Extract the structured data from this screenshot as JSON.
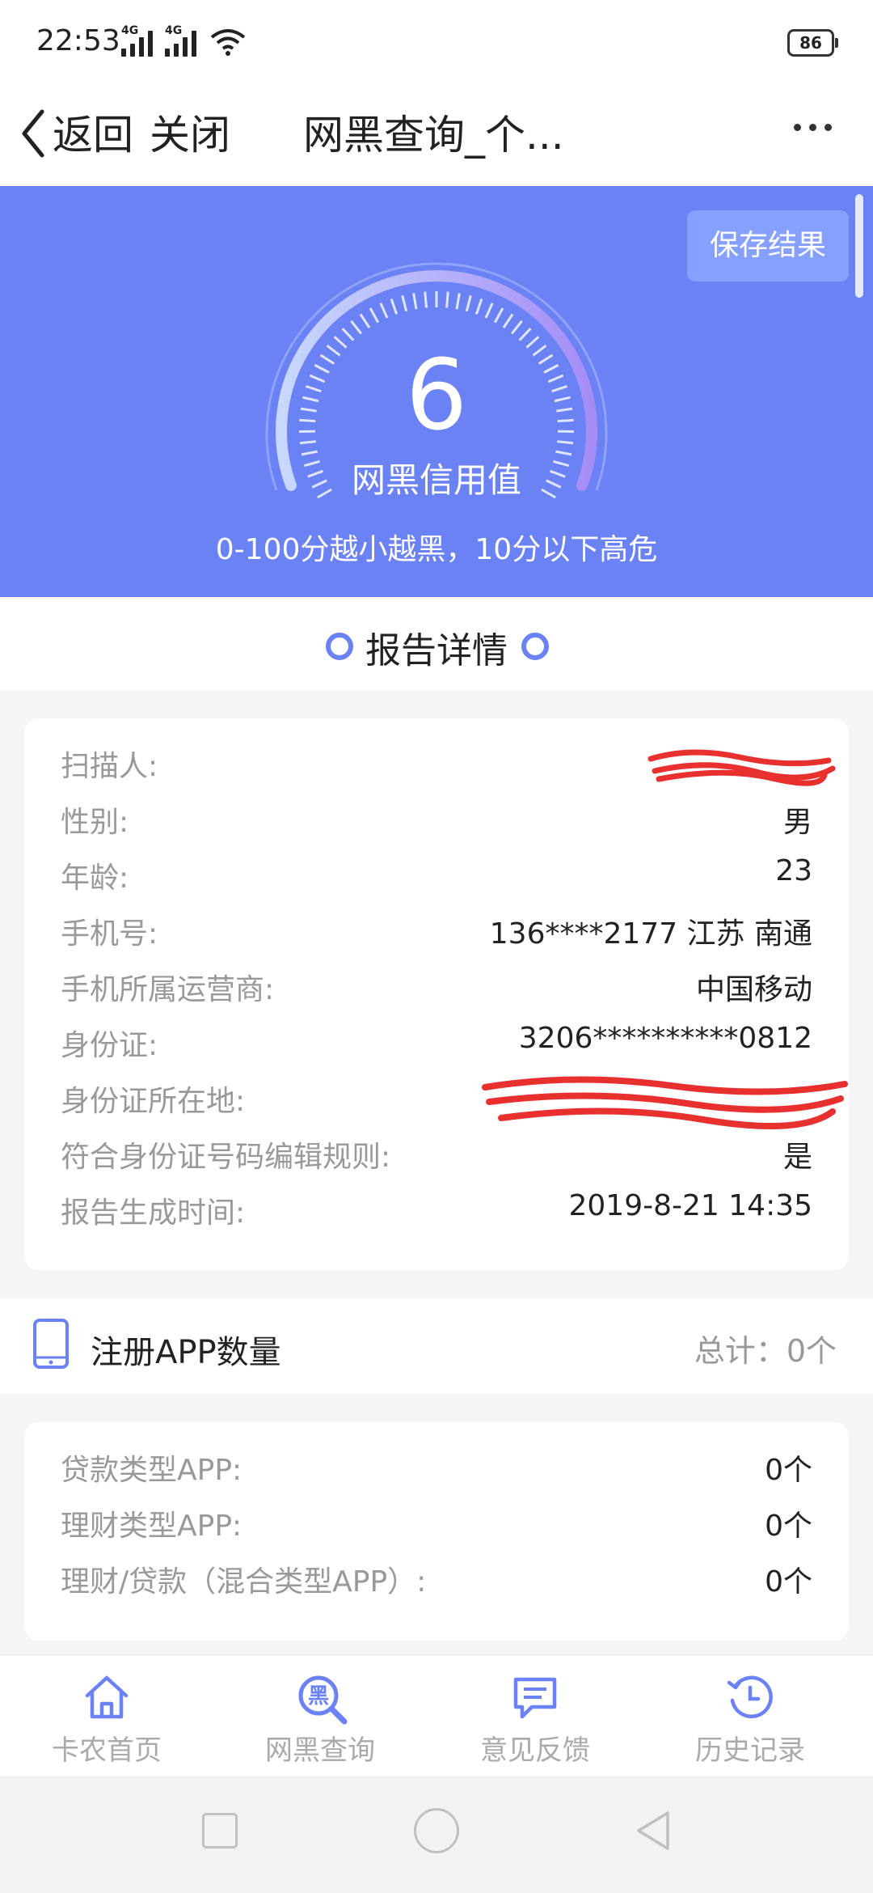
{
  "status_bar": {
    "time": "22:53",
    "net1": "4G",
    "net2": "4G",
    "battery": "86"
  },
  "navbar": {
    "back": "返回",
    "close": "关闭",
    "title": "网黑查询_个..."
  },
  "hero": {
    "save": "保存结果",
    "score": "6",
    "score_label": "网黑信用值",
    "hint": "0-100分越小越黑，10分以下高危"
  },
  "report": {
    "title": "报告详情"
  },
  "info": [
    {
      "k": "扫描人:",
      "v": ""
    },
    {
      "k": "性别:",
      "v": "男"
    },
    {
      "k": "年龄:",
      "v": "23"
    },
    {
      "k": "手机号:",
      "v": "136****2177 江苏 南通"
    },
    {
      "k": "手机所属运营商:",
      "v": "中国移动"
    },
    {
      "k": "身份证:",
      "v": "3206**********0812"
    },
    {
      "k": "身份证所在地:",
      "v": ""
    },
    {
      "k": "符合身份证号码编辑规则:",
      "v": "是"
    },
    {
      "k": "报告生成时间:",
      "v": "2019-8-21 14:35"
    }
  ],
  "apps": {
    "title": "注册APP数量",
    "total": "总计：0个",
    "rows": [
      {
        "k": "贷款类型APP:",
        "v": "0个"
      },
      {
        "k": "理财类型APP:",
        "v": "0个"
      },
      {
        "k": "理财/贷款（混合类型APP）:",
        "v": "0个"
      }
    ]
  },
  "tabs": [
    {
      "label": "卡农首页",
      "icon": "home-icon"
    },
    {
      "label": "网黑查询",
      "icon": "blacklist-search-icon",
      "glyph": "黑"
    },
    {
      "label": "意见反馈",
      "icon": "feedback-icon"
    },
    {
      "label": "历史记录",
      "icon": "history-icon"
    }
  ],
  "colors": {
    "accent": "#6b82f5",
    "accent_light": "#86a0ff",
    "muted": "#999999"
  }
}
